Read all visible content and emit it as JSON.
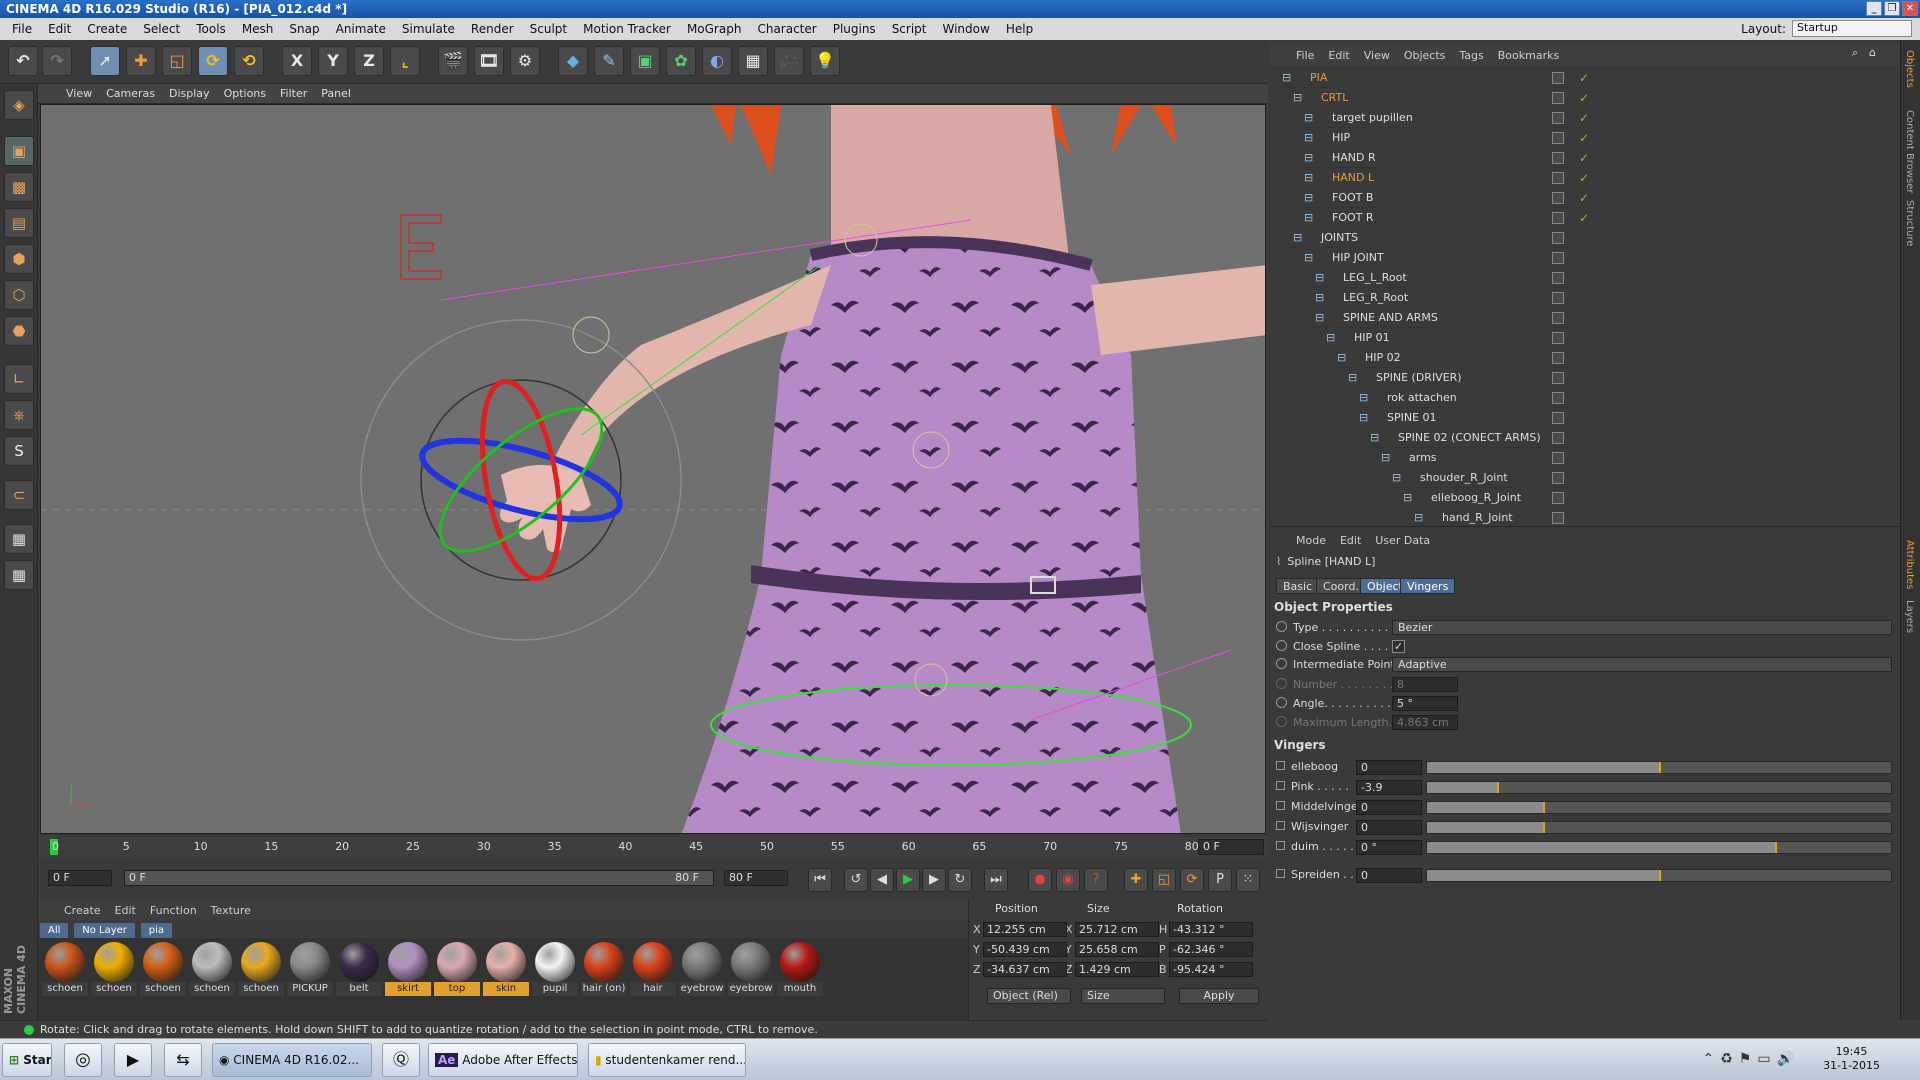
{
  "window": {
    "title": "CINEMA 4D R16.029 Studio (R16) - [PIA_012.c4d *]"
  },
  "menubar": {
    "items": [
      "File",
      "Edit",
      "Create",
      "Select",
      "Tools",
      "Mesh",
      "Snap",
      "Animate",
      "Simulate",
      "Render",
      "Sculpt",
      "Motion Tracker",
      "MoGraph",
      "Character",
      "Plugins",
      "Script",
      "Window",
      "Help"
    ],
    "layout_label": "Layout:",
    "layout_value": "Startup"
  },
  "toolbar": {
    "axis_x": "X",
    "axis_y": "Y",
    "axis_z": "Z"
  },
  "viewport": {
    "menu": [
      "View",
      "Cameras",
      "Display",
      "Options",
      "Filter",
      "Panel"
    ]
  },
  "timeline": {
    "ticks": [
      "0",
      "5",
      "10",
      "15",
      "20",
      "25",
      "30",
      "35",
      "40",
      "45",
      "50",
      "55",
      "60",
      "65",
      "70",
      "75",
      "80"
    ],
    "current_frame": "0 F"
  },
  "timectl": {
    "start": "0 F",
    "range_start": "0 F",
    "range_end": "80 F",
    "end": "80 F"
  },
  "material": {
    "menu": [
      "Create",
      "Edit",
      "Function",
      "Texture"
    ],
    "filters": [
      "All",
      "No Layer",
      "pia"
    ],
    "items": [
      {
        "name": "schoen",
        "color": "#c8551a",
        "hl": false
      },
      {
        "name": "schoen",
        "color": "#f0b000",
        "hl": false
      },
      {
        "name": "schoen",
        "color": "#d36019",
        "hl": false
      },
      {
        "name": "schoen",
        "color": "#bdbdbd",
        "hl": false
      },
      {
        "name": "schoen",
        "color": "#e8a820",
        "hl": false
      },
      {
        "name": "PICKUP",
        "color": "#8a8a8a",
        "hl": false
      },
      {
        "name": "belt",
        "color": "#3b2a4a",
        "hl": false
      },
      {
        "name": "skirt",
        "color": "#b08fc0",
        "hl": true
      },
      {
        "name": "top",
        "color": "#d9a9b2",
        "hl": true
      },
      {
        "name": "skin",
        "color": "#e6b0a8",
        "hl": true
      },
      {
        "name": "pupil",
        "color": "#f4f4f4",
        "hl": false
      },
      {
        "name": "hair (on)",
        "color": "#d9421a",
        "hl": false
      },
      {
        "name": "hair",
        "color": "#d9421a",
        "hl": false
      },
      {
        "name": "eyebrow",
        "color": "#7a7a7a",
        "hl": false
      },
      {
        "name": "eyebrow",
        "color": "#7a7a7a",
        "hl": false
      },
      {
        "name": "mouth",
        "color": "#b51a12",
        "hl": false
      }
    ]
  },
  "coords": {
    "headers": [
      "Position",
      "Size",
      "Rotation"
    ],
    "rows": [
      {
        "a": "X",
        "p": "12.255 cm",
        "b": "X",
        "s": "25.712 cm",
        "c": "H",
        "r": "-43.312 °"
      },
      {
        "a": "Y",
        "p": "-50.439 cm",
        "b": "Y",
        "s": "25.658 cm",
        "c": "P",
        "r": "-62.346 °"
      },
      {
        "a": "Z",
        "p": "-34.637 cm",
        "b": "Z",
        "s": "1.429 cm",
        "c": "B",
        "r": "-95.424 °"
      }
    ],
    "mode": "Object (Rel)",
    "size_mode": "Size",
    "apply": "Apply"
  },
  "status": {
    "text": "Rotate: Click and drag to rotate elements. Hold down SHIFT to add to quantize rotation / add to the selection in point mode, CTRL to remove."
  },
  "objects": {
    "menu": [
      "File",
      "Edit",
      "View",
      "Objects",
      "Tags",
      "Bookmarks"
    ],
    "rows": [
      {
        "name": "PIA",
        "indent": 0,
        "orange": true
      },
      {
        "name": "CRTL",
        "indent": 1,
        "orange": true
      },
      {
        "name": "target pupillen",
        "indent": 2,
        "orange": false
      },
      {
        "name": "HIP",
        "indent": 2,
        "orange": false
      },
      {
        "name": "HAND R",
        "indent": 2,
        "orange": false
      },
      {
        "name": "HAND L",
        "indent": 2,
        "orange": true
      },
      {
        "name": "FOOT B",
        "indent": 2,
        "orange": false
      },
      {
        "name": "FOOT R",
        "indent": 2,
        "orange": false
      },
      {
        "name": "JOINTS",
        "indent": 1,
        "orange": false
      },
      {
        "name": "HIP JOINT",
        "indent": 2,
        "orange": false
      },
      {
        "name": "LEG_L_Root",
        "indent": 3,
        "orange": false
      },
      {
        "name": "LEG_R_Root",
        "indent": 3,
        "orange": false
      },
      {
        "name": "SPINE AND ARMS",
        "indent": 3,
        "orange": false
      },
      {
        "name": "HIP 01",
        "indent": 4,
        "orange": false
      },
      {
        "name": "HIP 02",
        "indent": 5,
        "orange": false
      },
      {
        "name": "SPINE (DRIVER)",
        "indent": 6,
        "orange": false
      },
      {
        "name": "rok attachen",
        "indent": 7,
        "orange": false
      },
      {
        "name": "SPINE 01",
        "indent": 7,
        "orange": false
      },
      {
        "name": "SPINE 02 (CONECT ARMS)",
        "indent": 8,
        "orange": false
      },
      {
        "name": "arms",
        "indent": 9,
        "orange": false
      },
      {
        "name": "shouder_R_Joint",
        "indent": 10,
        "orange": false
      },
      {
        "name": "elleboog_R_Joint",
        "indent": 11,
        "orange": false
      },
      {
        "name": "hand_R_Joint",
        "indent": 12,
        "orange": false
      }
    ]
  },
  "attributes": {
    "menu": [
      "Mode",
      "Edit",
      "User Data"
    ],
    "title": "Spline [HAND L]",
    "tabs": [
      "Basic",
      "Coord.",
      "Object",
      "Vingers"
    ],
    "section1": "Object Properties",
    "type_label": "Type . . . . . . . . . . . .",
    "type_value": "Bezier",
    "close_label": "Close Spline . . . . .",
    "close_value": "✓",
    "inter_label": "Intermediate Points",
    "inter_value": "Adaptive",
    "number_label": "Number . . . . . . . . .",
    "number_value": "8",
    "angle_label": "Angle. . . . . . . . . . .",
    "angle_value": "5 °",
    "maxlen_label": "Maximum Length. .",
    "maxlen_value": "4.863 cm",
    "section2": "Vingers",
    "sliders": [
      {
        "label": "elleboog",
        "value": "0",
        "level": 0.5
      },
      {
        "label": "Pink . . . . .",
        "value": "-3.9",
        "level": 0.15
      },
      {
        "label": "Middelvinger",
        "value": "0",
        "level": 0.25
      },
      {
        "label": "Wijsvinger",
        "value": "0",
        "level": 0.25
      },
      {
        "label": "duim . . . . .",
        "value": "0 °",
        "level": 0.75
      },
      {
        "label": "Spreiden . . .",
        "value": "0",
        "level": 0.5
      }
    ]
  },
  "taskbar": {
    "start": "Start",
    "items": [
      "CINEMA 4D R16.02...",
      "Adobe After Effects ...",
      "studentenkamer rend..."
    ],
    "time": "19:45",
    "date": "31-1-2015"
  }
}
